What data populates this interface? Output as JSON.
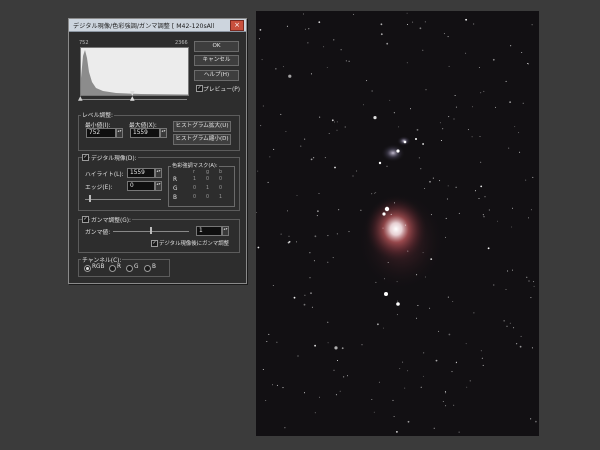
{
  "dialog": {
    "title": "デジタル現像/色彩強調/ガンマ調整 [ M42-120sAll",
    "close_glyph": "×",
    "histogram": {
      "min_label": "752",
      "max_label": "2366"
    },
    "buttons": {
      "ok": "OK",
      "cancel": "キャンセル",
      "help": "ヘルプ(H)",
      "hist_expand": "ヒストグラム拡大(U)",
      "hist_shrink": "ヒストグラム縮小(D)"
    },
    "preview": {
      "label": "プレビュー(P)",
      "checked": true
    },
    "levels": {
      "title": "レベル調整:",
      "min_label": "最小値(I):",
      "min_value": "752",
      "max_label": "最大値(X):",
      "max_value": "1559"
    },
    "digital": {
      "title": "デジタル現像(D):",
      "checked": true,
      "highlight_label": "ハイライト(L):",
      "highlight_value": "1559",
      "edge_label": "エッジ(E):",
      "edge_value": "0"
    },
    "color_mask": {
      "title": "色彩強調マスク(A):",
      "col_headers": [
        "r",
        "g",
        "b"
      ],
      "rows": [
        {
          "label": "R",
          "values": [
            "1",
            "0",
            "0"
          ]
        },
        {
          "label": "G",
          "values": [
            "0",
            "1",
            "0"
          ]
        },
        {
          "label": "B",
          "values": [
            "0",
            "0",
            "1"
          ]
        }
      ]
    },
    "gamma": {
      "title": "ガンマ調整(G):",
      "checked": true,
      "value_label": "ガンマ値:",
      "value": "1",
      "after_label": "デジタル現像後にガンマ調整",
      "after_checked": true
    },
    "channel": {
      "title": "チャンネル(C):",
      "options": [
        "RGB",
        "R",
        "G",
        "B"
      ],
      "selected": "RGB"
    }
  },
  "colors": {
    "background": "#3b3b3b",
    "dialog_bg": "#2d2d2d",
    "titlebar": "#cdd5de",
    "sky": "#121013",
    "nebula": "#c86464"
  }
}
